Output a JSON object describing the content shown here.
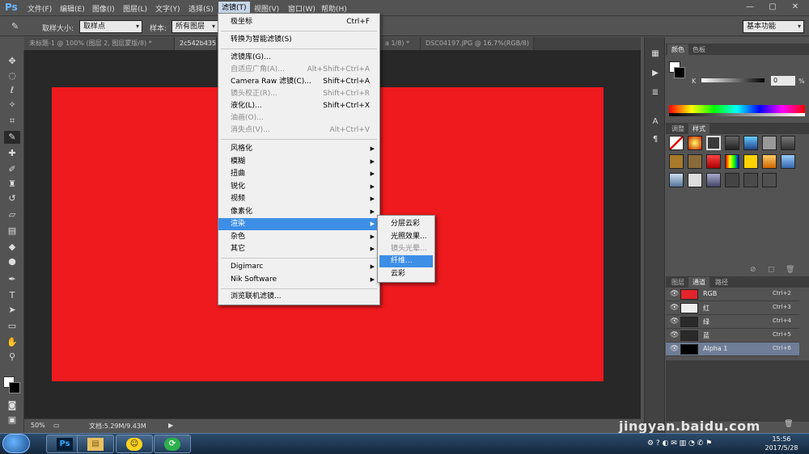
{
  "app": {
    "logo": "Ps"
  },
  "menubar": {
    "items": [
      "文件(F)",
      "编辑(E)",
      "图像(I)",
      "图层(L)",
      "文字(Y)",
      "选择(S)",
      "滤镜(T)",
      "视图(V)",
      "窗口(W)",
      "帮助(H)"
    ],
    "active_index": 6
  },
  "window_controls": {
    "minimize": "—",
    "restore": "▢",
    "close": "✕"
  },
  "options": {
    "sample_size_label": "取样大小:",
    "sample_size_value": "取样点",
    "sample_label": "样本:",
    "sample_value": "所有图层",
    "workspace_value": "基本功能"
  },
  "tabs": [
    {
      "label": "未标题-1 @ 100% (图层 2, 图层蒙版/8) *",
      "active": false
    },
    {
      "label": "2c542b435f",
      "active": true
    },
    {
      "label": "a 1/8) *",
      "active": false
    },
    {
      "label": "DSC04197.JPG @ 16.7%(RGB/8)",
      "active": false
    }
  ],
  "filter_menu": {
    "items": [
      {
        "label": "极坐标",
        "shortcut": "Ctrl+F",
        "disabled": false
      },
      {
        "label": "转换为智能滤镜(S)",
        "shortcut": "",
        "disabled": false
      },
      {
        "label": "滤镜库(G)...",
        "shortcut": "",
        "disabled": false
      },
      {
        "label": "自适应广角(A)...",
        "shortcut": "Alt+Shift+Ctrl+A",
        "disabled": true
      },
      {
        "label": "Camera Raw 滤镜(C)...",
        "shortcut": "Shift+Ctrl+A",
        "disabled": false
      },
      {
        "label": "镜头校正(R)...",
        "shortcut": "Shift+Ctrl+R",
        "disabled": true
      },
      {
        "label": "液化(L)...",
        "shortcut": "Shift+Ctrl+X",
        "disabled": false
      },
      {
        "label": "油画(O)...",
        "shortcut": "",
        "disabled": true
      },
      {
        "label": "消失点(V)...",
        "shortcut": "Alt+Ctrl+V",
        "disabled": true
      },
      {
        "label": "风格化",
        "submenu": true
      },
      {
        "label": "模糊",
        "submenu": true
      },
      {
        "label": "扭曲",
        "submenu": true
      },
      {
        "label": "锐化",
        "submenu": true
      },
      {
        "label": "视频",
        "submenu": true
      },
      {
        "label": "像素化",
        "submenu": true
      },
      {
        "label": "渲染",
        "submenu": true,
        "highlight": true
      },
      {
        "label": "杂色",
        "submenu": true
      },
      {
        "label": "其它",
        "submenu": true
      },
      {
        "label": "Digimarc",
        "submenu": true
      },
      {
        "label": "Nik Software",
        "submenu": true
      },
      {
        "label": "浏览联机滤镜...",
        "shortcut": ""
      }
    ]
  },
  "render_submenu": {
    "items": [
      {
        "label": "分层云彩",
        "disabled": false
      },
      {
        "label": "光照效果...",
        "disabled": false
      },
      {
        "label": "镜头光晕...",
        "disabled": true
      },
      {
        "label": "纤维...",
        "disabled": false,
        "highlight": true
      },
      {
        "label": "云彩",
        "disabled": false
      }
    ]
  },
  "status": {
    "zoom": "50%",
    "doc_size": "文档:5.29M/9.43M"
  },
  "color_panel": {
    "tabs": [
      "颜色",
      "色板"
    ],
    "channel_label": "K",
    "k_value": "0",
    "k_unit": "%"
  },
  "styles_panel": {
    "tabs": [
      "调整",
      "样式"
    ]
  },
  "channels_panel": {
    "tabs": [
      "图层",
      "通道",
      "路径"
    ],
    "channels": [
      {
        "name": "RGB",
        "shortcut": "Ctrl+2",
        "color": "#e3242b"
      },
      {
        "name": "红",
        "shortcut": "Ctrl+3",
        "color": "#eeeeee"
      },
      {
        "name": "绿",
        "shortcut": "Ctrl+4",
        "color": "#2a2a2a"
      },
      {
        "name": "蓝",
        "shortcut": "Ctrl+5",
        "color": "#2a2a2a"
      },
      {
        "name": "Alpha 1",
        "shortcut": "Ctrl+6",
        "color": "#000000",
        "selected": true
      }
    ]
  },
  "taskbar": {
    "apps": [
      "Ps",
      "▤",
      "☺",
      "⟳"
    ],
    "time": "15:56",
    "date": "2017/5/28"
  },
  "watermark": "jingyan.baidu.com",
  "colors": {
    "canvas": "#ee1a1e",
    "highlight": "#3d8ee6"
  }
}
